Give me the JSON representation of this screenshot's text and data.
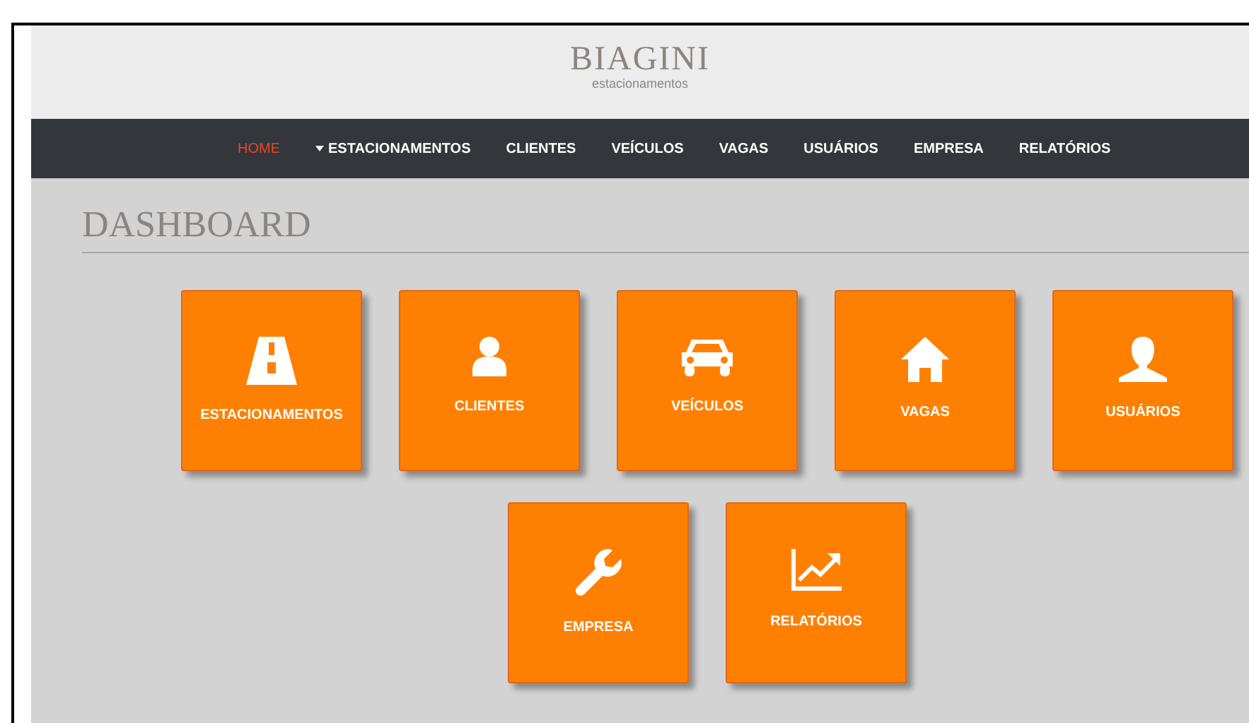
{
  "brand": {
    "name": "BIAGINI",
    "tagline": "estacionamentos"
  },
  "nav": [
    {
      "label": "HOME",
      "selected": true,
      "dropdown": false
    },
    {
      "label": "ESTACIONAMENTOS",
      "selected": false,
      "dropdown": true
    },
    {
      "label": "CLIENTES",
      "selected": false,
      "dropdown": false
    },
    {
      "label": "VEÍCULOS",
      "selected": false,
      "dropdown": false
    },
    {
      "label": "VAGAS",
      "selected": false,
      "dropdown": false
    },
    {
      "label": "USUÁRIOS",
      "selected": false,
      "dropdown": false
    },
    {
      "label": "EMPRESA",
      "selected": false,
      "dropdown": false
    },
    {
      "label": "RELATÓRIOS",
      "selected": false,
      "dropdown": false
    }
  ],
  "page_title": "DASHBOARD",
  "tiles": [
    {
      "label": "ESTACIONAMENTOS"
    },
    {
      "label": "CLIENTES"
    },
    {
      "label": "VEÍCULOS"
    },
    {
      "label": "VAGAS"
    },
    {
      "label": "USUÁRIOS"
    },
    {
      "label": "EMPRESA"
    },
    {
      "label": "RELATÓRIOS"
    }
  ]
}
